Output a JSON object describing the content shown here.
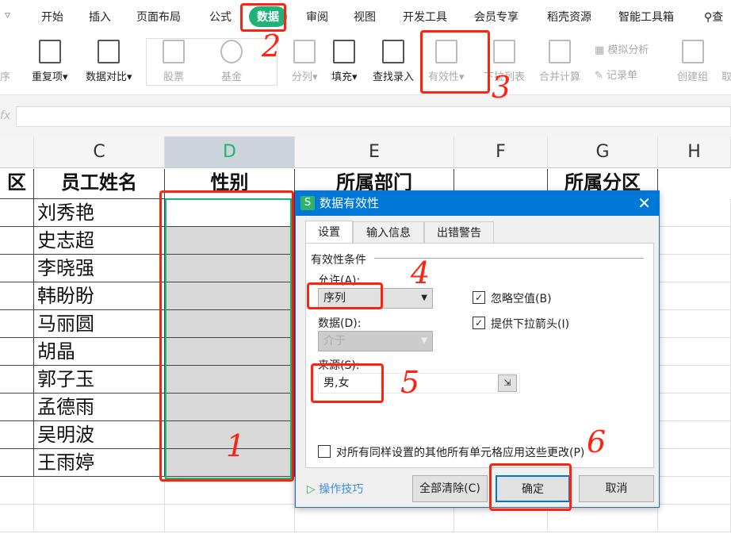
{
  "menu_tabs": [
    "开始",
    "插入",
    "页面布局",
    "公式",
    "数据",
    "审阅",
    "视图",
    "开发工具",
    "会员专享",
    "稻壳资源",
    "智能工具箱"
  ],
  "active_tab": "数据",
  "search_label": "查",
  "ribbon": {
    "partial_left": "序",
    "repeat": "重复项",
    "compare": "数据对比",
    "stock": "股票",
    "fund": "基金",
    "split": "分列",
    "fill": "填充",
    "lookup": "查找录入",
    "validity": "有效性",
    "dropdown": "下拉列表",
    "consolidate": "合并计算",
    "simulate": "模拟分析",
    "record": "记录单",
    "group": "创建组",
    "ungroup": "取"
  },
  "formula_bar": {
    "fx": "fx"
  },
  "columns": [
    "C",
    "D",
    "E",
    "F",
    "G",
    "H"
  ],
  "headers": {
    "b": "区",
    "c": "员工姓名",
    "d": "性别",
    "e": "所属部门",
    "g": "所属分区"
  },
  "names": [
    "刘秀艳",
    "史志超",
    "李晓强",
    "韩盼盼",
    "马丽圆",
    "胡晶",
    "郭子玉",
    "孟德雨",
    "吴明波",
    "王雨婷"
  ],
  "dialog": {
    "title": "数据有效性",
    "tabs": [
      "设置",
      "输入信息",
      "出错警告"
    ],
    "group": "有效性条件",
    "allow_label": "允许(A):",
    "allow_value": "序列",
    "data_label": "数据(D):",
    "data_value": "介于",
    "ignore_blank": "忽略空值(B)",
    "ignore_blank_checked": true,
    "dropdown_arrow": "提供下拉箭头(I)",
    "dropdown_arrow_checked": true,
    "source_label": "来源(S):",
    "source_value": "男,女",
    "apply_all": "对所有同样设置的其他所有单元格应用这些更改(P)",
    "apply_all_checked": false,
    "tips": "操作技巧",
    "clear_all": "全部清除(C)",
    "ok": "确定",
    "cancel": "取消"
  },
  "annotations": [
    "1",
    "2",
    "3",
    "4",
    "5",
    "6"
  ],
  "colors": {
    "accent": "#1fb37a",
    "dialog_title": "#0078d7",
    "annotation": "#ff2211"
  }
}
